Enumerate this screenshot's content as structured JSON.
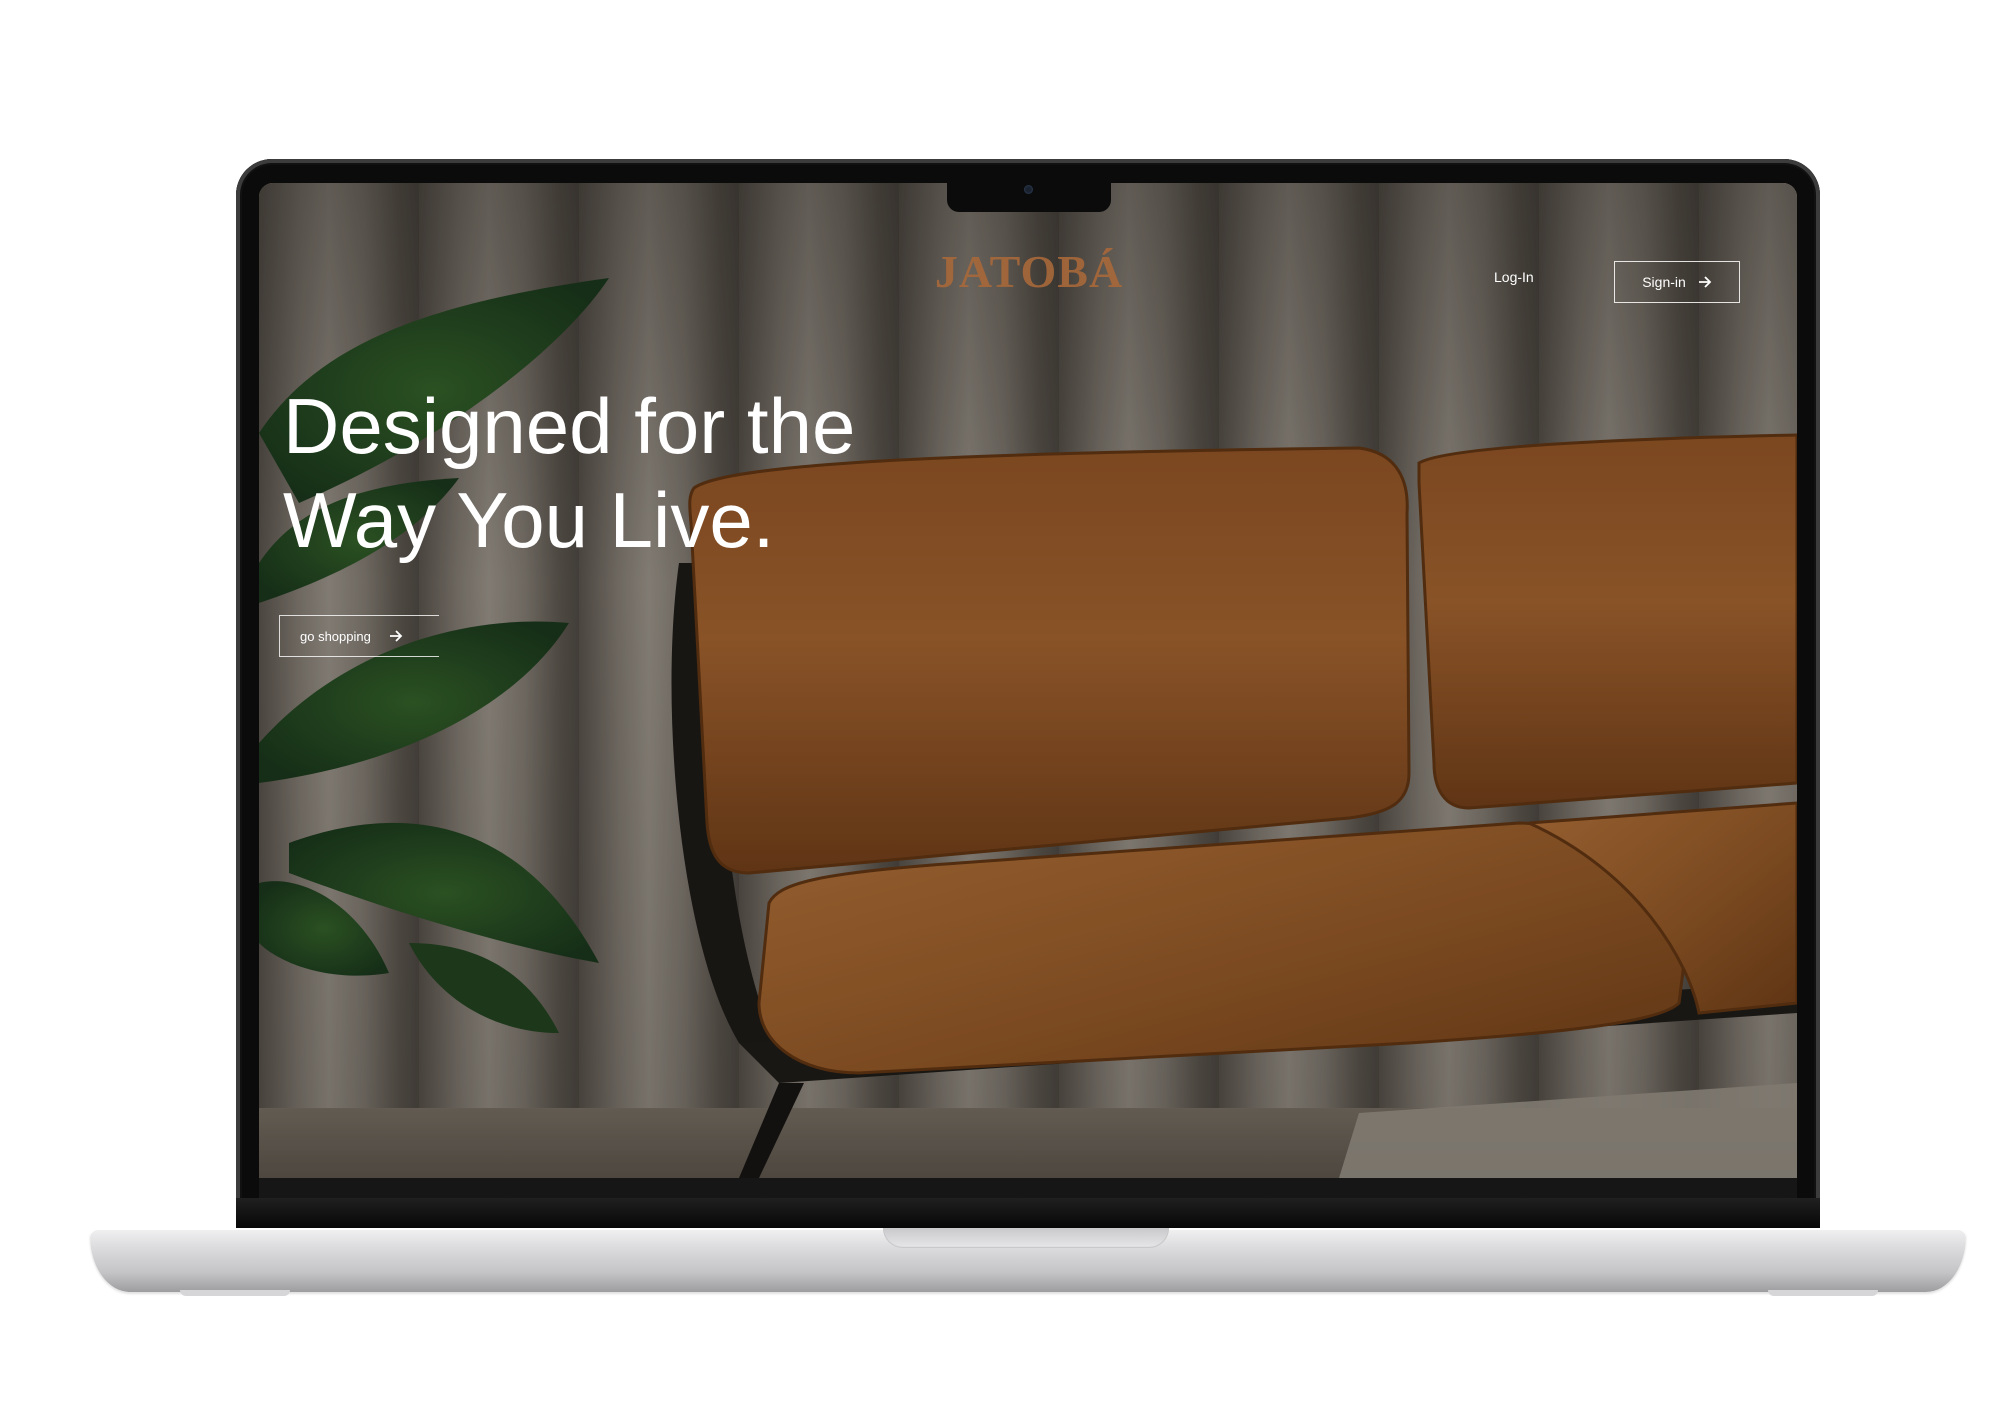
{
  "site": {
    "logo": "JATOBÁ",
    "brand_color": "#a8683a"
  },
  "nav": {
    "login_label": "Log-In",
    "signin_label": "Sign-in",
    "signin_icon": "arrow-right-icon"
  },
  "hero": {
    "headline_line1": "Designed for the",
    "headline_line2": "Way You Live.",
    "cta_label": "go shopping",
    "cta_icon": "arrow-right-icon",
    "background": "leather-sofa-photo",
    "text_color": "#ffffff"
  },
  "device": {
    "type": "laptop-mockup",
    "frame_color": "#0b0b0b",
    "base_color": "#d4d4d6"
  }
}
